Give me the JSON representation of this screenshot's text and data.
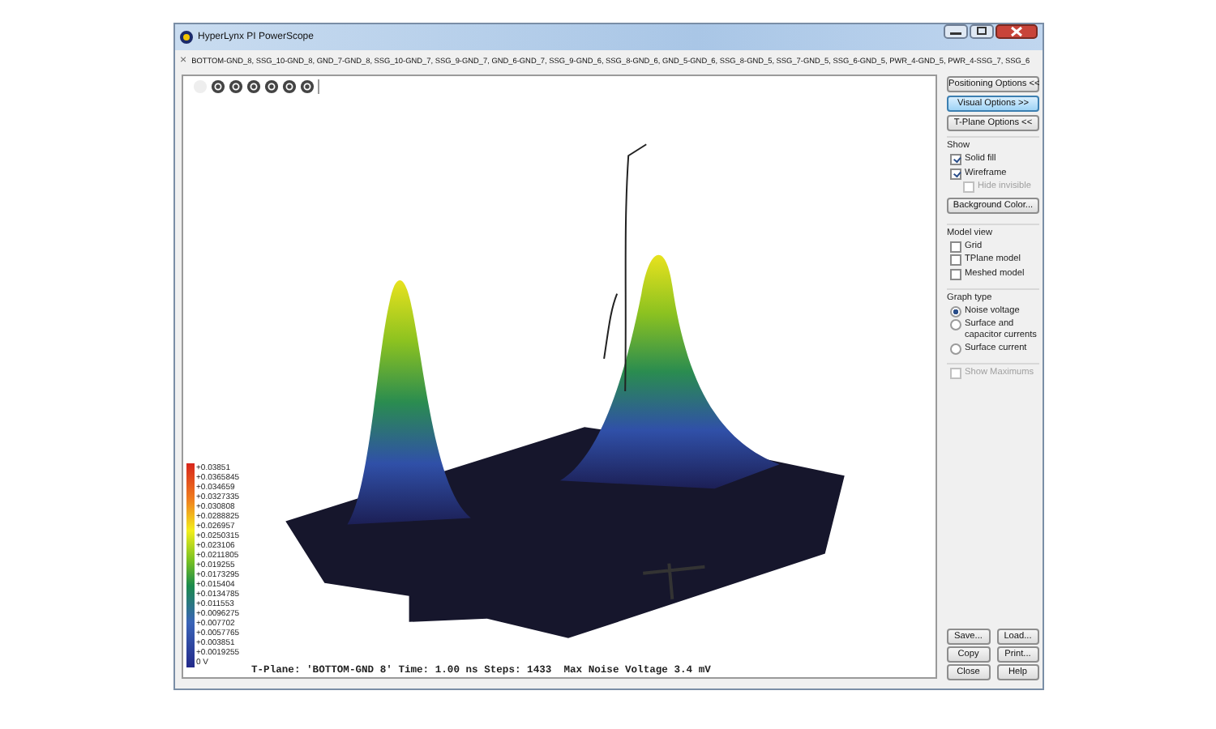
{
  "window": {
    "title": "HyperLynx PI PowerScope"
  },
  "tab": {
    "label": "BOTTOM-GND_8, SSG_10-GND_8, GND_7-GND_8, SSG_10-GND_7, SSG_9-GND_7, GND_6-GND_7, SSG_9-GND_6, SSG_8-GND_6, GND_5-GND_6, SSG_8-GND_5, SSG_7-GND_5, SSG_6-GND_5, PWR_4-GND_5, PWR_4-SSG_7, SSG_6",
    "close": "×"
  },
  "legend": {
    "labels": [
      "+0.03851",
      "+0.0365845",
      "+0.034659",
      "+0.0327335",
      "+0.030808",
      "+0.0288825",
      "+0.026957",
      "+0.0250315",
      "+0.023106",
      "+0.0211805",
      "+0.019255",
      "+0.0173295",
      "+0.015404",
      "+0.0134785",
      "+0.011553",
      "+0.0096275",
      "+0.007702",
      "+0.0057765",
      "+0.003851",
      "+0.0019255",
      "0 V"
    ]
  },
  "status": "T-Plane: 'BOTTOM-GND 8' Time: 1.00 ns Steps: 1433  Max Noise Voltage 3.4 mV",
  "panel": {
    "option_buttons": [
      {
        "label": "Positioning Options <<",
        "selected": false
      },
      {
        "label": "Visual Options >>",
        "selected": true
      },
      {
        "label": "T-Plane Options <<",
        "selected": false
      }
    ],
    "groups": [
      {
        "title": "Show",
        "items": [
          {
            "kind": "checkbox",
            "label": "Solid fill",
            "checked": true,
            "disabled": false
          },
          {
            "kind": "checkbox",
            "label": "Wireframe",
            "checked": true,
            "disabled": false
          },
          {
            "kind": "checkbox",
            "label": "Hide invisible",
            "checked": false,
            "disabled": true,
            "indent": true
          },
          {
            "kind": "button",
            "label": "Background Color..."
          }
        ]
      },
      {
        "title": "Model view",
        "items": [
          {
            "kind": "checkbox",
            "label": "Grid",
            "checked": false,
            "disabled": false
          },
          {
            "kind": "checkbox",
            "label": "TPlane model",
            "checked": false,
            "disabled": false
          },
          {
            "kind": "checkbox",
            "label": "Meshed model",
            "checked": false,
            "disabled": false
          }
        ]
      },
      {
        "title": "Graph type",
        "items": [
          {
            "kind": "radio",
            "label": "Noise voltage",
            "selected": true
          },
          {
            "kind": "radio",
            "label": "Surface and capacitor currents",
            "selected": false
          },
          {
            "kind": "radio",
            "label": "Surface current",
            "selected": false
          }
        ]
      },
      {
        "items": [
          {
            "kind": "checkbox",
            "label": "Show Maximums",
            "checked": false,
            "disabled": true
          }
        ]
      }
    ],
    "bottom_buttons": [
      "Save...",
      "Load...",
      "Copy",
      "Print...",
      "Close",
      "Help"
    ]
  }
}
